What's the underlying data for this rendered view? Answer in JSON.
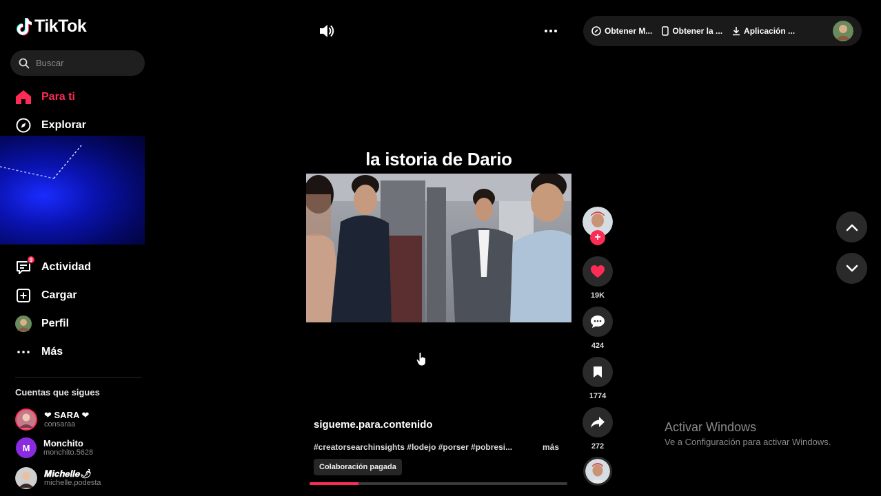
{
  "app": {
    "logo_text": "TikTok"
  },
  "search": {
    "placeholder": "Buscar"
  },
  "nav": {
    "items": [
      {
        "label": "Para ti",
        "icon": "home-icon",
        "active": true
      },
      {
        "label": "Explorar",
        "icon": "compass-icon"
      },
      {
        "label": "Actividad",
        "icon": "inbox-icon",
        "badge": "9"
      },
      {
        "label": "Cargar",
        "icon": "plus-square-icon"
      },
      {
        "label": "Perfil",
        "icon": "avatar"
      },
      {
        "label": "Más",
        "icon": "more-icon"
      }
    ]
  },
  "following": {
    "title": "Cuentas que sigues",
    "accounts": [
      {
        "name": "❤ SARA ❤",
        "handle": "consaraa"
      },
      {
        "name": "Monchito",
        "handle": "monchito.5628",
        "initial": "M"
      },
      {
        "name": "𝑴𝒊𝒄𝒉𝒆𝒍𝒍𝒆🌶",
        "handle": "michelle.podesta"
      }
    ]
  },
  "topbar": {
    "buttons": [
      {
        "label": "Obtener M...",
        "icon": "coin-icon"
      },
      {
        "label": "Obtener la ...",
        "icon": "phone-icon"
      },
      {
        "label": "Aplicación ...",
        "icon": "download-icon"
      }
    ]
  },
  "video": {
    "title": "la istoria de Dario",
    "author": "sigueme.para.contenido",
    "description": "#creatorsearchinsights #lodejo #porser #pobresi...",
    "more_label": "más",
    "collab_label": "Colaboración pagada",
    "progress": 0.19
  },
  "actions": {
    "likes": "19K",
    "comments": "424",
    "saves": "1774",
    "shares": "272"
  },
  "watermark": {
    "title": "Activar Windows",
    "subtitle": "Ve a Configuración para activar Windows."
  },
  "colors": {
    "accent": "#fe2c55",
    "background": "#000000",
    "surface": "#2a2a2a"
  }
}
